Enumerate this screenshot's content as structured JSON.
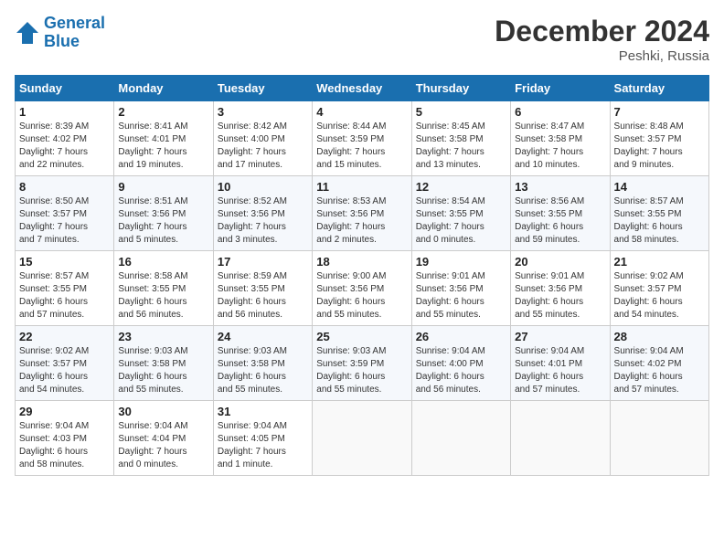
{
  "header": {
    "logo_line1": "General",
    "logo_line2": "Blue",
    "month_year": "December 2024",
    "location": "Peshki, Russia"
  },
  "weekdays": [
    "Sunday",
    "Monday",
    "Tuesday",
    "Wednesday",
    "Thursday",
    "Friday",
    "Saturday"
  ],
  "weeks": [
    [
      {
        "day": "1",
        "info": "Sunrise: 8:39 AM\nSunset: 4:02 PM\nDaylight: 7 hours\nand 22 minutes."
      },
      {
        "day": "2",
        "info": "Sunrise: 8:41 AM\nSunset: 4:01 PM\nDaylight: 7 hours\nand 19 minutes."
      },
      {
        "day": "3",
        "info": "Sunrise: 8:42 AM\nSunset: 4:00 PM\nDaylight: 7 hours\nand 17 minutes."
      },
      {
        "day": "4",
        "info": "Sunrise: 8:44 AM\nSunset: 3:59 PM\nDaylight: 7 hours\nand 15 minutes."
      },
      {
        "day": "5",
        "info": "Sunrise: 8:45 AM\nSunset: 3:58 PM\nDaylight: 7 hours\nand 13 minutes."
      },
      {
        "day": "6",
        "info": "Sunrise: 8:47 AM\nSunset: 3:58 PM\nDaylight: 7 hours\nand 10 minutes."
      },
      {
        "day": "7",
        "info": "Sunrise: 8:48 AM\nSunset: 3:57 PM\nDaylight: 7 hours\nand 9 minutes."
      }
    ],
    [
      {
        "day": "8",
        "info": "Sunrise: 8:50 AM\nSunset: 3:57 PM\nDaylight: 7 hours\nand 7 minutes."
      },
      {
        "day": "9",
        "info": "Sunrise: 8:51 AM\nSunset: 3:56 PM\nDaylight: 7 hours\nand 5 minutes."
      },
      {
        "day": "10",
        "info": "Sunrise: 8:52 AM\nSunset: 3:56 PM\nDaylight: 7 hours\nand 3 minutes."
      },
      {
        "day": "11",
        "info": "Sunrise: 8:53 AM\nSunset: 3:56 PM\nDaylight: 7 hours\nand 2 minutes."
      },
      {
        "day": "12",
        "info": "Sunrise: 8:54 AM\nSunset: 3:55 PM\nDaylight: 7 hours\nand 0 minutes."
      },
      {
        "day": "13",
        "info": "Sunrise: 8:56 AM\nSunset: 3:55 PM\nDaylight: 6 hours\nand 59 minutes."
      },
      {
        "day": "14",
        "info": "Sunrise: 8:57 AM\nSunset: 3:55 PM\nDaylight: 6 hours\nand 58 minutes."
      }
    ],
    [
      {
        "day": "15",
        "info": "Sunrise: 8:57 AM\nSunset: 3:55 PM\nDaylight: 6 hours\nand 57 minutes."
      },
      {
        "day": "16",
        "info": "Sunrise: 8:58 AM\nSunset: 3:55 PM\nDaylight: 6 hours\nand 56 minutes."
      },
      {
        "day": "17",
        "info": "Sunrise: 8:59 AM\nSunset: 3:55 PM\nDaylight: 6 hours\nand 56 minutes."
      },
      {
        "day": "18",
        "info": "Sunrise: 9:00 AM\nSunset: 3:56 PM\nDaylight: 6 hours\nand 55 minutes."
      },
      {
        "day": "19",
        "info": "Sunrise: 9:01 AM\nSunset: 3:56 PM\nDaylight: 6 hours\nand 55 minutes."
      },
      {
        "day": "20",
        "info": "Sunrise: 9:01 AM\nSunset: 3:56 PM\nDaylight: 6 hours\nand 55 minutes."
      },
      {
        "day": "21",
        "info": "Sunrise: 9:02 AM\nSunset: 3:57 PM\nDaylight: 6 hours\nand 54 minutes."
      }
    ],
    [
      {
        "day": "22",
        "info": "Sunrise: 9:02 AM\nSunset: 3:57 PM\nDaylight: 6 hours\nand 54 minutes."
      },
      {
        "day": "23",
        "info": "Sunrise: 9:03 AM\nSunset: 3:58 PM\nDaylight: 6 hours\nand 55 minutes."
      },
      {
        "day": "24",
        "info": "Sunrise: 9:03 AM\nSunset: 3:58 PM\nDaylight: 6 hours\nand 55 minutes."
      },
      {
        "day": "25",
        "info": "Sunrise: 9:03 AM\nSunset: 3:59 PM\nDaylight: 6 hours\nand 55 minutes."
      },
      {
        "day": "26",
        "info": "Sunrise: 9:04 AM\nSunset: 4:00 PM\nDaylight: 6 hours\nand 56 minutes."
      },
      {
        "day": "27",
        "info": "Sunrise: 9:04 AM\nSunset: 4:01 PM\nDaylight: 6 hours\nand 57 minutes."
      },
      {
        "day": "28",
        "info": "Sunrise: 9:04 AM\nSunset: 4:02 PM\nDaylight: 6 hours\nand 57 minutes."
      }
    ],
    [
      {
        "day": "29",
        "info": "Sunrise: 9:04 AM\nSunset: 4:03 PM\nDaylight: 6 hours\nand 58 minutes."
      },
      {
        "day": "30",
        "info": "Sunrise: 9:04 AM\nSunset: 4:04 PM\nDaylight: 7 hours\nand 0 minutes."
      },
      {
        "day": "31",
        "info": "Sunrise: 9:04 AM\nSunset: 4:05 PM\nDaylight: 7 hours\nand 1 minute."
      },
      {
        "day": "",
        "info": ""
      },
      {
        "day": "",
        "info": ""
      },
      {
        "day": "",
        "info": ""
      },
      {
        "day": "",
        "info": ""
      }
    ]
  ]
}
